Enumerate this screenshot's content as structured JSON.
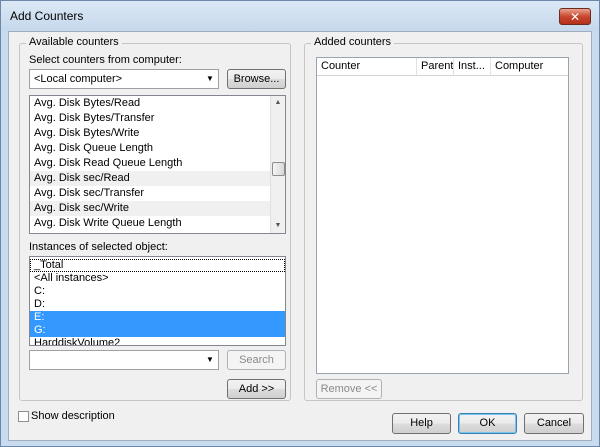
{
  "window": {
    "title": "Add Counters",
    "close_glyph": "✕"
  },
  "available": {
    "group_title": "Available counters",
    "select_label": "Select counters from computer:",
    "computer_value": "<Local computer>",
    "browse_label": "Browse...",
    "counters": [
      "Avg. Disk Bytes/Read",
      "Avg. Disk Bytes/Transfer",
      "Avg. Disk Bytes/Write",
      "Avg. Disk Queue Length",
      "Avg. Disk Read Queue Length",
      "Avg. Disk sec/Read",
      "Avg. Disk sec/Transfer",
      "Avg. Disk sec/Write",
      "Avg. Disk Write Queue Length"
    ],
    "instances_label": "Instances of selected object:",
    "instances": [
      "_Total",
      "<All instances>",
      "C:",
      "D:",
      "E:",
      "G:",
      "HarddiskVolume2"
    ],
    "search_value": "",
    "search_label": "Search",
    "add_label": "Add >>"
  },
  "added": {
    "group_title": "Added counters",
    "columns": [
      "Counter",
      "Parent",
      "Inst...",
      "Computer"
    ],
    "remove_label": "Remove <<"
  },
  "footer": {
    "show_description": "Show description",
    "help": "Help",
    "ok": "OK",
    "cancel": "Cancel"
  }
}
